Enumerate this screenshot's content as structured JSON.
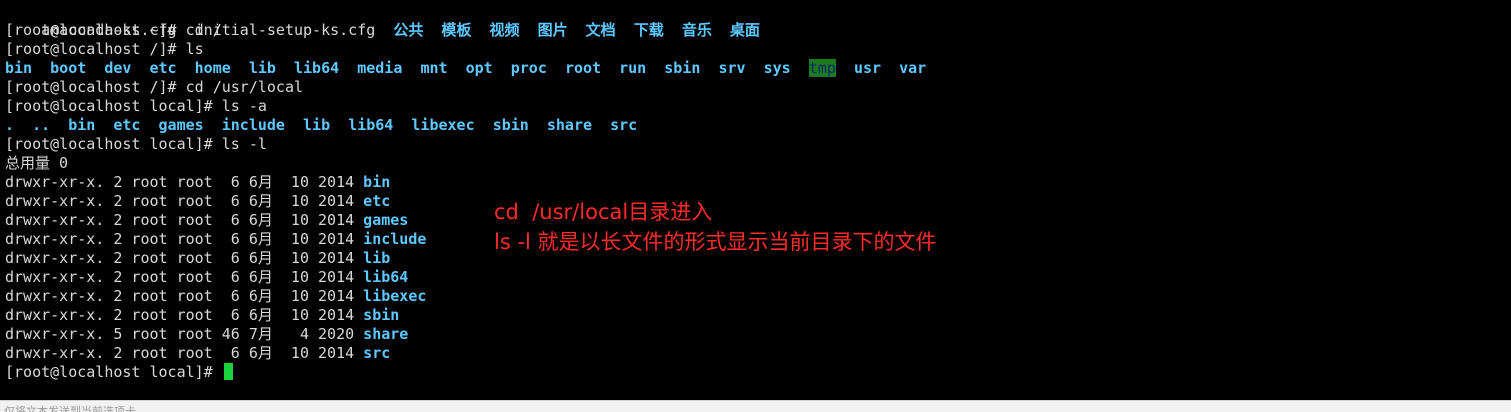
{
  "terminal": {
    "line1": {
      "files": [
        "anaconda-ks.cfg",
        "initial-setup-ks.cfg"
      ],
      "dirs": [
        "公共",
        "模板",
        "视频",
        "图片",
        "文档",
        "下载",
        "音乐",
        "桌面"
      ]
    },
    "line2": "[root@localhost ~]# cd /",
    "line3": "[root@localhost /]# ls",
    "line4": {
      "dirs_a": [
        "bin",
        "boot",
        "dev",
        "etc",
        "home",
        "lib",
        "lib64",
        "media",
        "mnt",
        "opt",
        "proc",
        "root",
        "run",
        "sbin",
        "srv",
        "sys"
      ],
      "tmp": "tmp",
      "dirs_b": [
        "usr",
        "var"
      ]
    },
    "line5": "[root@localhost /]# cd /usr/local",
    "line6": "[root@localhost local]# ls -a",
    "line7": {
      "dirs": [
        ".",
        "..",
        "bin",
        "etc",
        "games",
        "include",
        "lib",
        "lib64",
        "libexec",
        "sbin",
        "share",
        "src"
      ]
    },
    "line8": "[root@localhost local]# ls -l",
    "line9": "总用量 0",
    "listing": [
      {
        "meta": "drwxr-xr-x. 2 root root  6 6月  10 2014 ",
        "name": "bin"
      },
      {
        "meta": "drwxr-xr-x. 2 root root  6 6月  10 2014 ",
        "name": "etc"
      },
      {
        "meta": "drwxr-xr-x. 2 root root  6 6月  10 2014 ",
        "name": "games"
      },
      {
        "meta": "drwxr-xr-x. 2 root root  6 6月  10 2014 ",
        "name": "include"
      },
      {
        "meta": "drwxr-xr-x. 2 root root  6 6月  10 2014 ",
        "name": "lib"
      },
      {
        "meta": "drwxr-xr-x. 2 root root  6 6月  10 2014 ",
        "name": "lib64"
      },
      {
        "meta": "drwxr-xr-x. 2 root root  6 6月  10 2014 ",
        "name": "libexec"
      },
      {
        "meta": "drwxr-xr-x. 2 root root  6 6月  10 2014 ",
        "name": "sbin"
      },
      {
        "meta": "drwxr-xr-x. 5 root root 46 7月   4 2020 ",
        "name": "share"
      },
      {
        "meta": "drwxr-xr-x. 2 root root  6 6月  10 2014 ",
        "name": "src"
      }
    ],
    "prompt_last": "[root@localhost local]# "
  },
  "annotation": {
    "line1": "cd  /usr/local目录进入",
    "line2": "ls -l 就是以长文件的形式显示当前目录下的文件"
  },
  "statusbar": {
    "text": "仅将文本发送到当前选项卡"
  },
  "colors": {
    "background": "#000000",
    "text": "#d8d8d8",
    "directory": "#5fc8ff",
    "tmp_bg": "#1e7a1e",
    "cursor": "#19d23c",
    "annotation": "#ff2a2a"
  }
}
